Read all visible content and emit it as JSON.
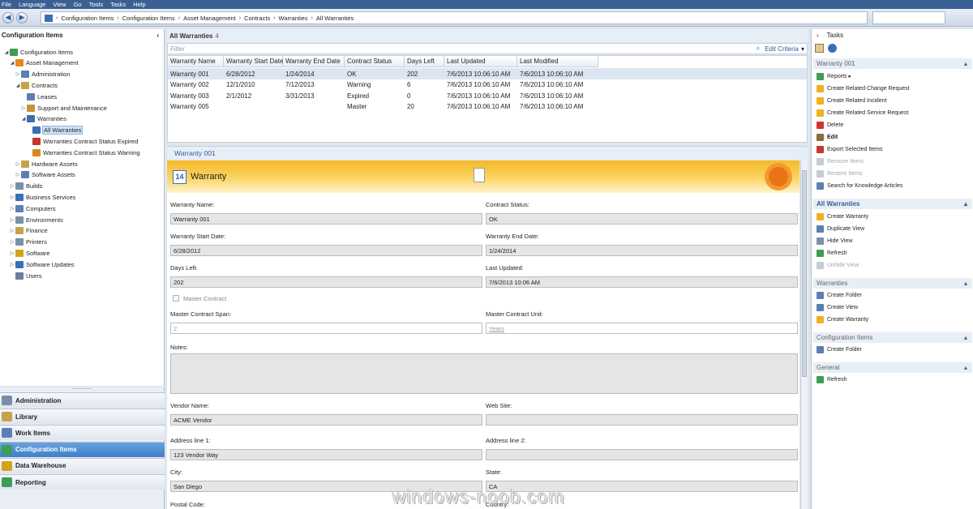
{
  "menubar": [
    "File",
    "Language",
    "View",
    "Go",
    "Tools",
    "Tasks",
    "Help"
  ],
  "breadcrumb": [
    "Configuration Items",
    "Configuration Items",
    "Asset Management",
    "Contracts",
    "Warranties",
    "All Warranties"
  ],
  "left": {
    "title": "Configuration Items",
    "tree": [
      {
        "label": "Configuration Items",
        "level": 0,
        "arrow": "◢",
        "color": "#3d9d52"
      },
      {
        "label": "Asset Management",
        "level": 1,
        "arrow": "◢",
        "color": "#e28a18"
      },
      {
        "label": "Administration",
        "level": 2,
        "arrow": "▷",
        "color": "#5b7fb3"
      },
      {
        "label": "Contracts",
        "level": 2,
        "arrow": "◢",
        "color": "#c8a24a"
      },
      {
        "label": "Leases",
        "level": 3,
        "arrow": "",
        "color": "#5b7fb3"
      },
      {
        "label": "Support and Maintenance",
        "level": 3,
        "arrow": "▷",
        "color": "#c89238"
      },
      {
        "label": "Warranties",
        "level": 3,
        "arrow": "◢",
        "color": "#3a6fb5"
      },
      {
        "label": "All Warranties",
        "level": 4,
        "arrow": "",
        "color": "#3a6fb5",
        "selected": true
      },
      {
        "label": "Warranties Contract Status Expired",
        "level": 4,
        "arrow": "",
        "color": "#c0392b"
      },
      {
        "label": "Warranties Contract Status Warning",
        "level": 4,
        "arrow": "",
        "color": "#d68a1a"
      },
      {
        "label": "Hardware Assets",
        "level": 2,
        "arrow": "▷",
        "color": "#c8a24a"
      },
      {
        "label": "Software Assets",
        "level": 2,
        "arrow": "▷",
        "color": "#5b7fb3"
      },
      {
        "label": "Builds",
        "level": 1,
        "arrow": "▷",
        "color": "#7a8fa8"
      },
      {
        "label": "Business Services",
        "level": 1,
        "arrow": "▷",
        "color": "#3a6fb5"
      },
      {
        "label": "Computers",
        "level": 1,
        "arrow": "▷",
        "color": "#5b7fb3"
      },
      {
        "label": "Environments",
        "level": 1,
        "arrow": "▷",
        "color": "#7a8fa8"
      },
      {
        "label": "Finance",
        "level": 1,
        "arrow": "▷",
        "color": "#c8a24a"
      },
      {
        "label": "Printers",
        "level": 1,
        "arrow": "▷",
        "color": "#7a8fa8"
      },
      {
        "label": "Software",
        "level": 1,
        "arrow": "▷",
        "color": "#d6a21a"
      },
      {
        "label": "Software Updates",
        "level": 1,
        "arrow": "▷",
        "color": "#3a6fb5"
      },
      {
        "label": "Users",
        "level": 1,
        "arrow": "",
        "color": "#6a7fa0"
      }
    ],
    "wunderbar": [
      {
        "label": "Administration",
        "color": "#7a8fa8"
      },
      {
        "label": "Library",
        "color": "#c8a24a"
      },
      {
        "label": "Work Items",
        "color": "#5b7fb3"
      },
      {
        "label": "Configuration Items",
        "color": "#3d9d52",
        "active": true
      },
      {
        "label": "Data Warehouse",
        "color": "#d6a21a"
      },
      {
        "label": "Reporting",
        "color": "#3d9d52"
      }
    ]
  },
  "list": {
    "title": "All Warranties",
    "count": "4",
    "filter_placeholder": "Filter",
    "edit_criteria": "Edit Criteria",
    "columns": [
      "Warranty Name",
      "Warranty Start Date",
      "Warranty End Date",
      "Contract Status",
      "Days Left",
      "Last Updated",
      "Last Modified"
    ],
    "rows": [
      [
        "Warranty 001",
        "6/28/2012",
        "1/24/2014",
        "OK",
        "202",
        "7/6/2013 10:06:10 AM",
        "7/6/2013 10:06:10 AM"
      ],
      [
        "Warranty 002",
        "12/1/2010",
        "7/12/2013",
        "Warning",
        "6",
        "7/6/2013 10:06:10 AM",
        "7/6/2013 10:06:10 AM"
      ],
      [
        "Warranty 003",
        "2/1/2012",
        "3/31/2013",
        "Expired",
        "0",
        "7/6/2013 10:06:10 AM",
        "7/6/2013 10:06:10 AM"
      ],
      [
        "Warranty 005",
        "",
        "",
        "Master",
        "20",
        "7/6/2013 10:06:10 AM",
        "7/6/2013 10:06:10 AM"
      ]
    ]
  },
  "form": {
    "header": "Warranty 001",
    "banner_title": "Warranty",
    "banner_icon_text": "14",
    "fields": {
      "warranty_name_label": "Warranty Name:",
      "warranty_name": "Warranty 001",
      "contract_status_label": "Contract Status:",
      "contract_status": "OK",
      "start_label": "Warranty Start Date:",
      "start": "6/28/2012",
      "end_label": "Warranty End Date:",
      "end": "1/24/2014",
      "days_left_label": "Days Left:",
      "days_left": "202",
      "last_updated_label": "Last Updated:",
      "last_updated": "7/6/2013 10:06 AM",
      "master_contract_label": "Master Contract",
      "master_span_label": "Master Contract Span:",
      "master_span": "2",
      "master_unit_label": "Master Contract Unit:",
      "master_unit": "Years",
      "notes_label": "Notes:",
      "vendor_label": "Vendor Name:",
      "vendor": "ACME Vendor",
      "website_label": "Web Site:",
      "website": "",
      "addr1_label": "Address line 1:",
      "addr1": "123 Vendor Way",
      "addr2_label": "Address line 2:",
      "addr2": "",
      "city_label": "City:",
      "city": "San Diego",
      "state_label": "State:",
      "state": "CA",
      "postal_label": "Postal Code:",
      "country_label": "Country:"
    }
  },
  "tasks": {
    "title": "Tasks",
    "sections": [
      {
        "title": "Warranty 001",
        "strong": false,
        "items": [
          {
            "label": "Reports ▸",
            "color": "#3d9d52"
          },
          {
            "label": "Create Related Change Request",
            "color": "#f2b01e"
          },
          {
            "label": "Create Related Incident",
            "color": "#f2b01e"
          },
          {
            "label": "Create Related Service Request",
            "color": "#f2b01e"
          },
          {
            "label": "Delete",
            "color": "#d0342c"
          },
          {
            "label": "Edit",
            "color": "#8a6d3b",
            "bold": true
          },
          {
            "label": "Export Selected Items",
            "color": "#c0392b"
          },
          {
            "label": "Remove Items",
            "color": "#c5ccd4",
            "disabled": true
          },
          {
            "label": "Restore Items",
            "color": "#c5ccd4",
            "disabled": true
          },
          {
            "label": "Search for Knowledge Articles",
            "color": "#5b7fb3"
          }
        ]
      },
      {
        "title": "All Warranties",
        "strong": true,
        "items": [
          {
            "label": "Create Warranty",
            "color": "#f2b01e"
          },
          {
            "label": "Duplicate View",
            "color": "#5b7fb3"
          },
          {
            "label": "Hide View",
            "color": "#7a8fa8"
          },
          {
            "label": "Refresh",
            "color": "#3d9d52"
          },
          {
            "label": "Unhide View",
            "color": "#c5ccd4",
            "disabled": true
          }
        ]
      },
      {
        "title": "Warranties",
        "strong": false,
        "items": [
          {
            "label": "Create Folder",
            "color": "#5b7fb3"
          },
          {
            "label": "Create View",
            "color": "#5b7fb3"
          },
          {
            "label": "Create Warranty",
            "color": "#f2b01e"
          }
        ]
      },
      {
        "title": "Configuration Items",
        "strong": false,
        "items": [
          {
            "label": "Create Folder",
            "color": "#5b7fb3"
          }
        ]
      },
      {
        "title": "General",
        "strong": false,
        "items": [
          {
            "label": "Refresh",
            "color": "#3d9d52"
          }
        ]
      }
    ]
  },
  "watermark": "windows-noob.com"
}
